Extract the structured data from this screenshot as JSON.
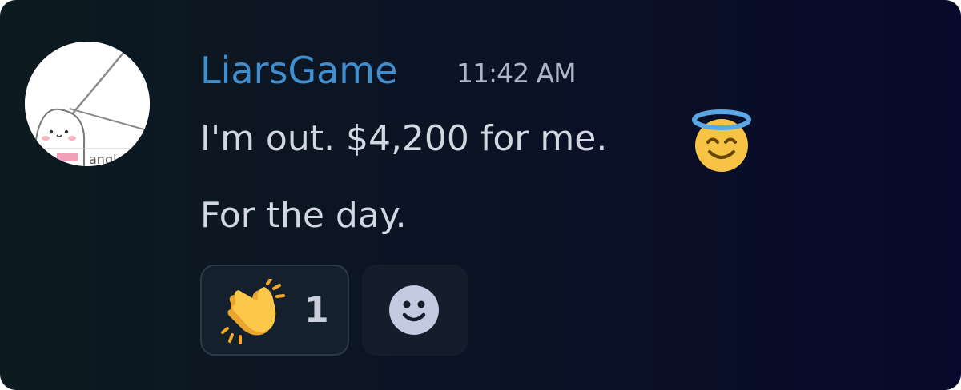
{
  "message": {
    "author": "LiarsGame",
    "timestamp": "11:42 AM",
    "lines": [
      "I'm out. $4,200 for me.",
      "For the day."
    ],
    "avatar_caption": "angl"
  },
  "reactions": [
    {
      "icon": "clapping-hands-icon",
      "count": "1"
    }
  ],
  "add_reaction_icon": "smiley-icon",
  "colors": {
    "background": "#0b1424",
    "username": "#3f8fd0",
    "timestamp": "#aeb5c7",
    "message_text": "#d2d7e1",
    "reaction_bg": "#15202e"
  }
}
